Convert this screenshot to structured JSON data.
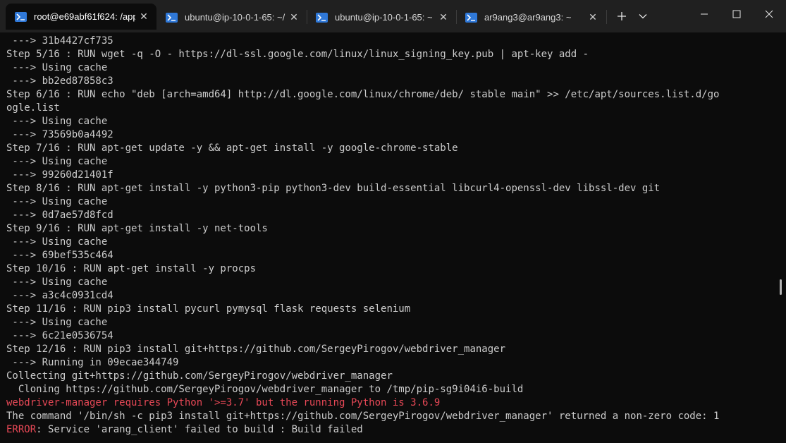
{
  "tabs": [
    {
      "title": "root@e69abf61f624: /app",
      "active": true
    },
    {
      "title": "ubuntu@ip-10-0-1-65: ~/",
      "active": false
    },
    {
      "title": "ubuntu@ip-10-0-1-65: ~",
      "active": false
    },
    {
      "title": "ar9ang3@ar9ang3: ~",
      "active": false
    }
  ],
  "tab_icon": "powershell-prompt-icon",
  "window_controls": [
    "new-tab-icon",
    "dropdown-icon",
    "minimize-icon",
    "maximize-icon",
    "close-icon"
  ],
  "colors": {
    "error": "#e74856",
    "text": "#cccccc",
    "background": "#0c0c0c",
    "tab_icon": "#2f78d8"
  },
  "terminal": {
    "lines": [
      " ---> 31b4427cf735",
      "Step 5/16 : RUN wget -q -O - https://dl-ssl.google.com/linux/linux_signing_key.pub | apt-key add -",
      " ---> Using cache",
      " ---> bb2ed87858c3",
      "Step 6/16 : RUN echo \"deb [arch=amd64] http://dl.google.com/linux/chrome/deb/ stable main\" >> /etc/apt/sources.list.d/go",
      "ogle.list",
      " ---> Using cache",
      " ---> 73569b0a4492",
      "Step 7/16 : RUN apt-get update -y && apt-get install -y google-chrome-stable",
      " ---> Using cache",
      " ---> 99260d21401f",
      "Step 8/16 : RUN apt-get install -y python3-pip python3-dev build-essential libcurl4-openssl-dev libssl-dev git",
      " ---> Using cache",
      " ---> 0d7ae57d8fcd",
      "Step 9/16 : RUN apt-get install -y net-tools",
      " ---> Using cache",
      " ---> 69bef535c464",
      "Step 10/16 : RUN apt-get install -y procps",
      " ---> Using cache",
      " ---> a3c4c0931cd4",
      "Step 11/16 : RUN pip3 install pycurl pymysql flask requests selenium",
      " ---> Using cache",
      " ---> 6c21e0536754",
      "Step 12/16 : RUN pip3 install git+https://github.com/SergeyPirogov/webdriver_manager",
      " ---> Running in 09ecae344749",
      "Collecting git+https://github.com/SergeyPirogov/webdriver_manager",
      "  Cloning https://github.com/SergeyPirogov/webdriver_manager to /tmp/pip-sg9i04i6-build",
      "webdriver-manager requires Python '>=3.7' but the running Python is 3.6.9",
      "The command '/bin/sh -c pip3 install git+https://github.com/SergeyPirogov/webdriver_manager' returned a non-zero code: 1"
    ],
    "error_line": {
      "prefix": "ERROR",
      "rest": ": Service 'arang_client' failed to build : Build failed"
    }
  }
}
